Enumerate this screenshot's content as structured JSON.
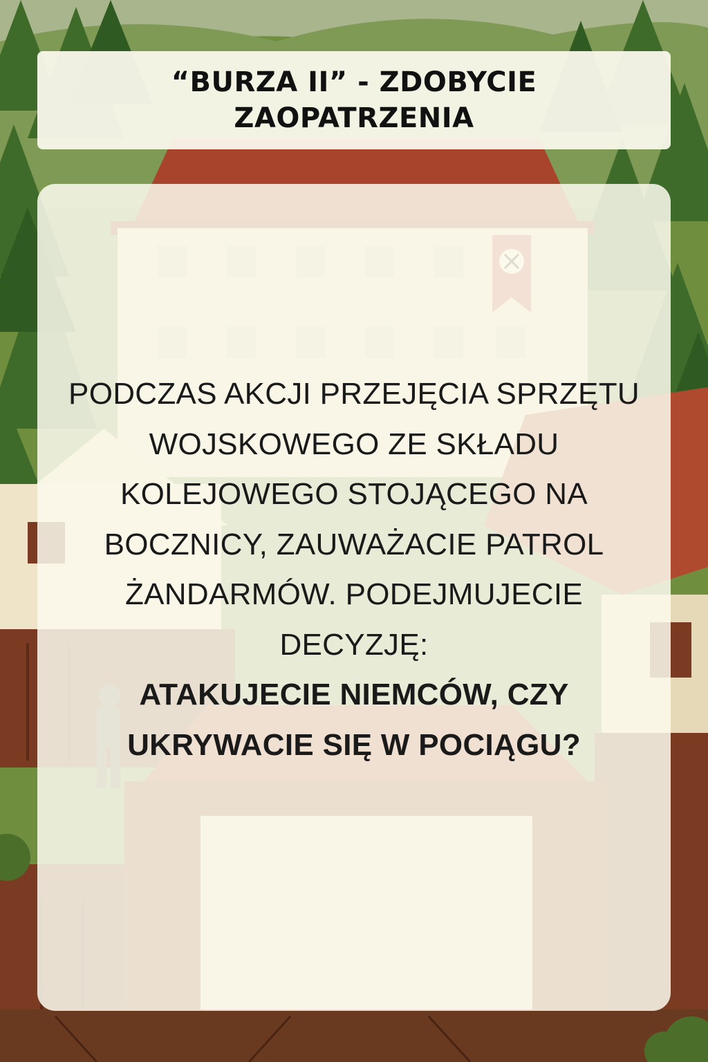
{
  "card": {
    "title": "“BURZA II” - ZDOBYCIE ZAOPATRZENIA",
    "description": "PODCZAS AKCJI PRZEJĘCIA SPRZĘTU WOJSKOWEGO ZE SKŁADU KOLEJOWEGO STOJĄCEGO NA BOCZNICY, ZAUWAŻACIE PATROL ŻANDARMÓW. PODEJMUJECIE DECYZJĘ:",
    "question": "ATAKUJECIE NIEMCÓW, CZY UKRYWACIE SIĘ W POCIĄGU?"
  },
  "colors": {
    "sky": "#a9b58c",
    "forest_dark": "#3f6b2a",
    "forest_mid": "#5a8a34",
    "roof_red": "#a8442c",
    "wall_cream": "#e8dcc0",
    "wood_brown": "#7a3b22",
    "card_bg": "#fbf9ec",
    "text": "#111111"
  }
}
